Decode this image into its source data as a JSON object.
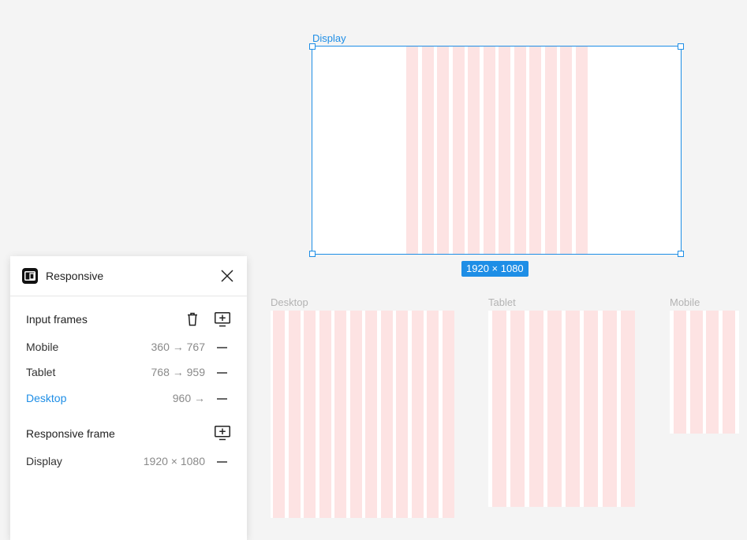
{
  "canvas": {
    "selected_frame": {
      "label": "Display",
      "size_badge": "1920 × 1080",
      "grid_columns": 12
    },
    "frames": [
      {
        "label": "Desktop",
        "grid_columns": 12
      },
      {
        "label": "Tablet",
        "grid_columns": 8
      },
      {
        "label": "Mobile",
        "grid_columns": 4
      }
    ]
  },
  "panel": {
    "title": "Responsive",
    "input_frames": {
      "title": "Input frames",
      "items": [
        {
          "label": "Mobile",
          "range": "360 → 767"
        },
        {
          "label": "Tablet",
          "range": "768 → 959"
        },
        {
          "label": "Desktop",
          "range": "960 →"
        }
      ]
    },
    "responsive_frame": {
      "title": "Responsive frame",
      "items": [
        {
          "label": "Display",
          "range": "1920 × 1080"
        }
      ]
    }
  },
  "colors": {
    "accent": "#1e8ee6",
    "grid_column": "#fde3e3",
    "canvas_bg": "#f4f4f4"
  }
}
